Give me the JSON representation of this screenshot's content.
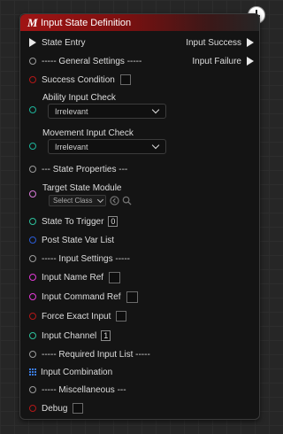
{
  "node": {
    "icon_letter": "M",
    "title": "Input State Definition"
  },
  "exec_in": {
    "label": "State Entry"
  },
  "exec_out": [
    {
      "label": "Input Success"
    },
    {
      "label": "Input Failure"
    }
  ],
  "pins": {
    "general_settings": "----- General Settings -----",
    "success_condition": "Success Condition",
    "ability_input_check": "Ability Input Check",
    "ability_input_value": "Irrelevant",
    "movement_input_check": "Movement Input Check",
    "movement_input_value": "Irrelevant",
    "state_properties": "--- State Properties ---",
    "target_state_module": "Target State Module",
    "target_state_placeholder": "Select Class",
    "state_to_trigger": "State To Trigger",
    "state_to_trigger_value": "0",
    "post_state_var_list": "Post State Var List",
    "input_settings": "----- Input Settings -----",
    "input_name_ref": "Input Name Ref",
    "input_command_ref": "Input Command Ref",
    "force_exact_input": "Force Exact Input",
    "input_channel": "Input Channel",
    "input_channel_value": "1",
    "required_input_list": "----- Required Input List -----",
    "input_combination": "Input Combination",
    "miscellaneous": "----- Miscellaneous ---",
    "debug": "Debug"
  },
  "colors": {
    "header_red": "#a01414",
    "exec_white": "#e8e8e8",
    "bool_red": "#b31717",
    "enum_teal": "#1db39a",
    "class_purple": "#d87ad8",
    "int_green": "#22c08e",
    "struct_blue": "#2a5cd6",
    "name_magenta": "#e23ad6"
  },
  "icons": [
    "clock-icon",
    "exec-pin-icon",
    "chevron-down-icon",
    "browse-icon",
    "search-icon",
    "array-grid-icon"
  ]
}
